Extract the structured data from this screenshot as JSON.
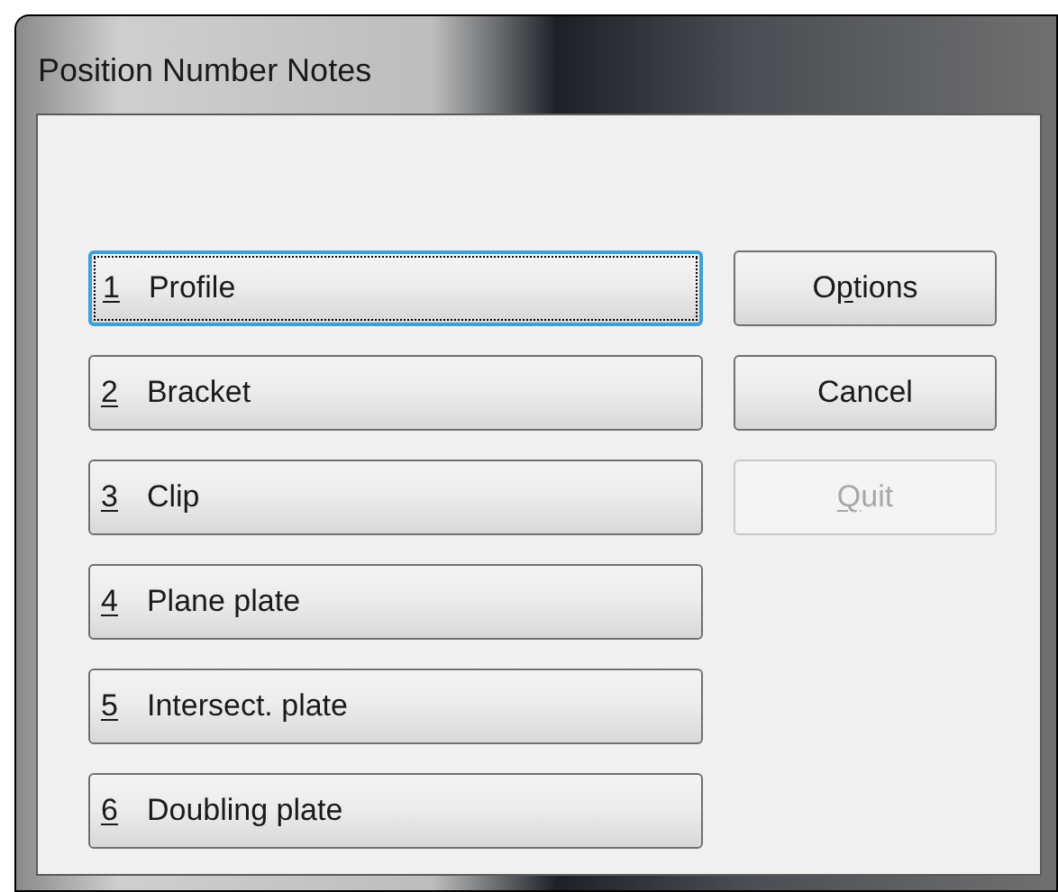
{
  "window": {
    "title": "Position Number Notes"
  },
  "choices": [
    {
      "key": "1",
      "label": "Profile",
      "focused": true
    },
    {
      "key": "2",
      "label": "Bracket",
      "focused": false
    },
    {
      "key": "3",
      "label": "Clip",
      "focused": false
    },
    {
      "key": "4",
      "label": "Plane plate",
      "focused": false
    },
    {
      "key": "5",
      "label": "Intersect. plate",
      "focused": false
    },
    {
      "key": "6",
      "label": "Doubling plate",
      "focused": false
    }
  ],
  "buttons": [
    {
      "label_parts": [
        {
          "text": "O",
          "underlined": false
        },
        {
          "text": "p",
          "underlined": true
        },
        {
          "text": "tions",
          "underlined": false
        }
      ],
      "disabled": false
    },
    {
      "label_parts": [
        {
          "text": "Cancel",
          "underlined": false
        }
      ],
      "disabled": false
    },
    {
      "label_parts": [
        {
          "text": "Q",
          "underlined": true
        },
        {
          "text": "uit",
          "underlined": false
        }
      ],
      "disabled": true
    }
  ]
}
